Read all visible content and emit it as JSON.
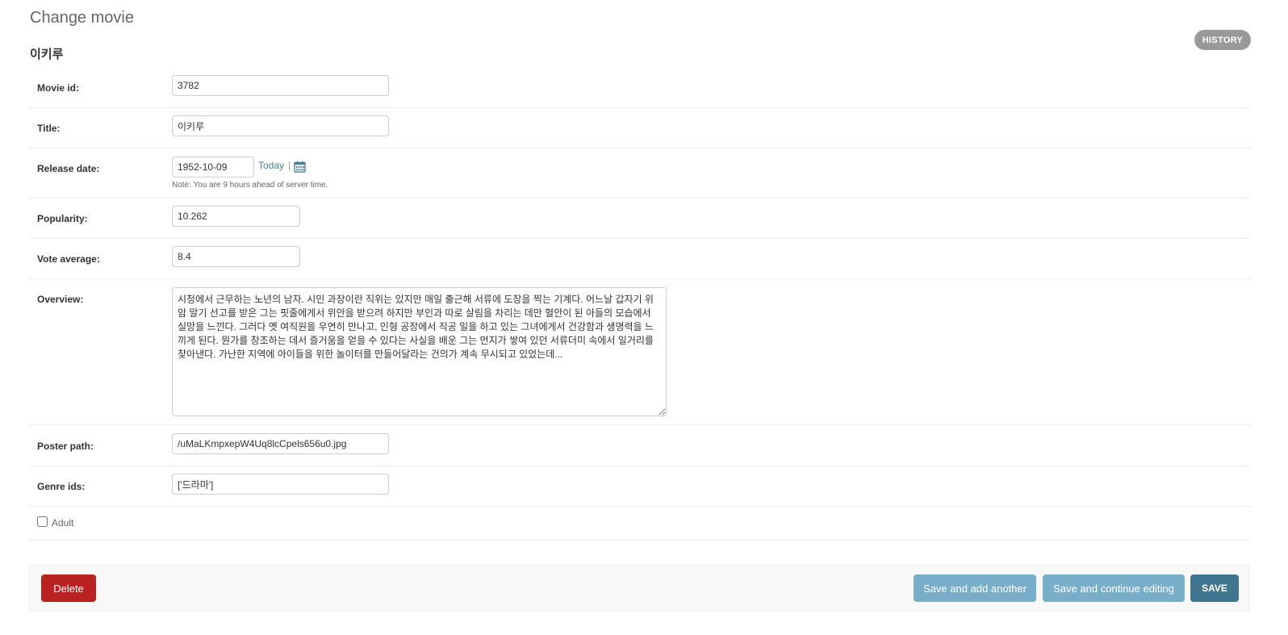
{
  "page": {
    "title": "Change movie",
    "object_title": "이키루"
  },
  "object_tools": {
    "history_label": "HISTORY"
  },
  "fields": {
    "movie_id": {
      "label": "Movie id:",
      "value": "3782"
    },
    "title": {
      "label": "Title:",
      "value": "이키루"
    },
    "release_date": {
      "label": "Release date:",
      "value": "1952-10-09",
      "today_label": "Today",
      "separator": "|",
      "calendar_icon": "calendar-icon",
      "help": "Note: You are 9 hours ahead of server time."
    },
    "popularity": {
      "label": "Popularity:",
      "value": "10.262"
    },
    "vote_average": {
      "label": "Vote average:",
      "value": "8.4"
    },
    "overview": {
      "label": "Overview:",
      "value": "시청에서 근무하는 노년의 남자. 시민 과장이란 직위는 있지만 매일 출근해 서류에 도장을 찍는 기계다. 어느날 갑자기 위암 말기 선고를 받은 그는 핏줄에게서 위안을 받으려 하지만 부인과 따로 살림을 차리는 데만 혈안이 된 아들의 모습에서 실망을 느낀다. 그러다 옛 여직원을 우연히 만나고, 인형 공장에서 직공 일을 하고 있는 그녀에게서 건강함과 생명력을 느끼게 된다. 뭔가를 창조하는 데서 즐거움을 얻을 수 있다는 사실을 배운 그는 먼지가 쌓여 있던 서류더미 속에서 일거리를 찾아낸다. 가난한 지역에 아이들을 위한 놀이터를 만들어달라는 건의가 계속 무시되고 있었는데..."
    },
    "poster_path": {
      "label": "Poster path:",
      "value": "/uMaLKmpxepW4Uq8lcCpels656u0.jpg"
    },
    "genre_ids": {
      "label": "Genre ids:",
      "value": "['드라마']"
    },
    "adult": {
      "label": "Adult",
      "checked": false
    }
  },
  "submit": {
    "delete_label": "Delete",
    "save_add_another_label": "Save and add another",
    "save_continue_label": "Save and continue editing",
    "save_label": "SAVE"
  },
  "colors": {
    "accent": "#417690",
    "link": "#447e9b",
    "delete": "#ba2121",
    "secondary_button": "#79aec8",
    "history": "#999999"
  }
}
